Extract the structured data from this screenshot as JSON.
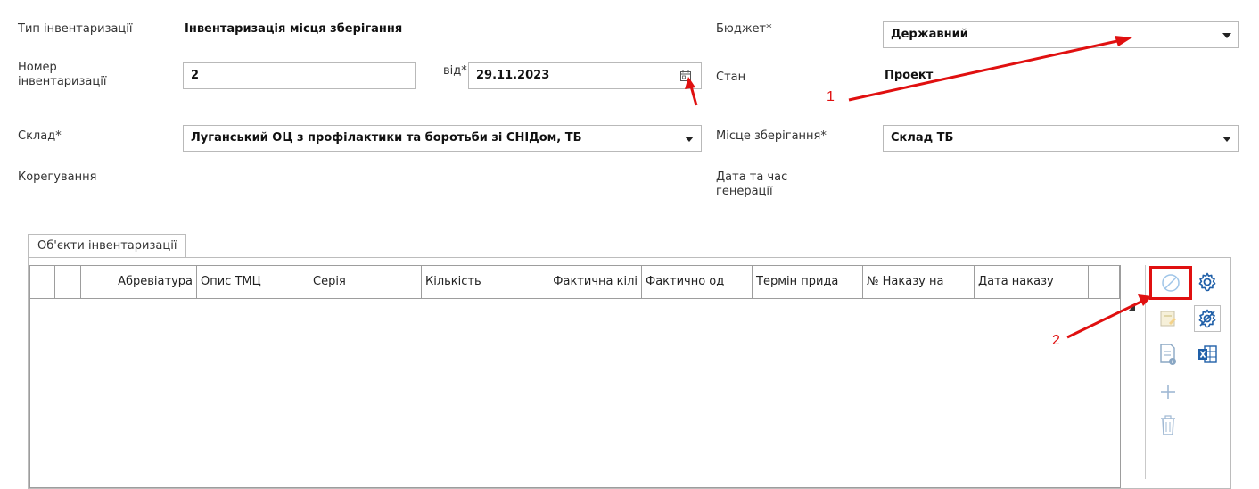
{
  "form": {
    "inventory_type_label": "Тип інвентаризації",
    "inventory_type_value": "Інвентаризація місця зберігання",
    "number_label": "Номер інвентаризації",
    "number_value": "2",
    "date_label": "від*",
    "date_value": "29.11.2023",
    "warehouse_label": "Склад*",
    "warehouse_value": "Луганський ОЦ з профілактики та боротьби зі СНІДом, ТБ",
    "correction_label": "Корегування",
    "budget_label": "Бюджет*",
    "budget_value": "Державний",
    "status_label": "Стан",
    "status_value": "Проект",
    "storage_label": "Місце зберігання*",
    "storage_value": "Склад ТБ",
    "generated_label": "Дата та час генерації"
  },
  "tabs": [
    {
      "label": "Об'єкти інвентаризації"
    }
  ],
  "grid": {
    "columns": [
      "",
      "",
      "Абревіатура",
      "Опис ТМЦ",
      "Серія",
      "Кількість",
      "Фактична кілі",
      "Фактично од",
      "Термін прида",
      "№ Наказу на",
      "Дата наказу",
      ""
    ],
    "rows": []
  },
  "toolbar": [
    {
      "icon": "clear-filter-icon",
      "enabled": false,
      "highlighted": true
    },
    {
      "icon": "settings-gear-icon",
      "enabled": true
    },
    {
      "icon": "edit-document-icon",
      "enabled": false
    },
    {
      "icon": "settings-gear-alt-icon",
      "enabled": true
    },
    {
      "icon": "document-info-icon",
      "enabled": false
    },
    {
      "icon": "excel-export-icon",
      "enabled": true
    },
    {
      "icon": "plus-icon",
      "enabled": false
    },
    {
      "icon": "trash-icon",
      "enabled": false
    }
  ],
  "annotations": [
    {
      "label": "1",
      "color": "#e01010"
    },
    {
      "label": "2",
      "color": "#e01010"
    }
  ]
}
